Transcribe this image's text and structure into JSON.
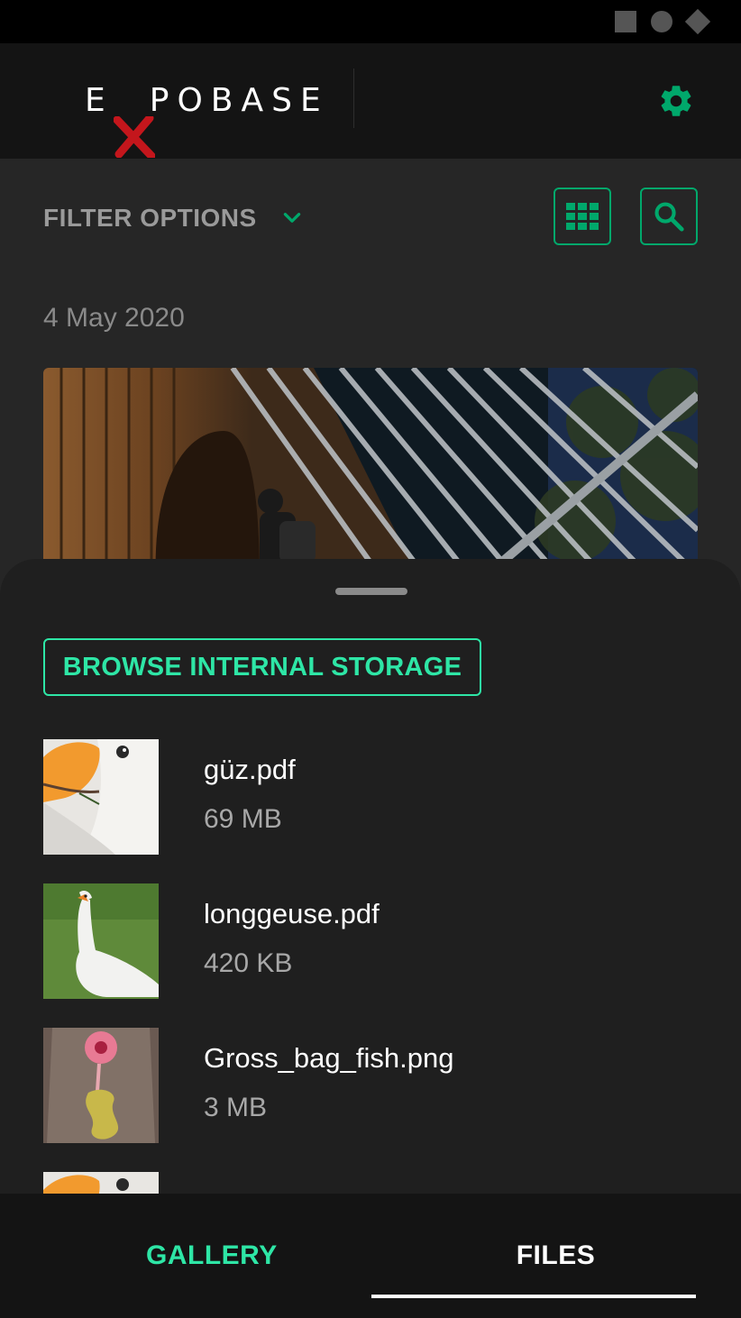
{
  "app": {
    "logo_text_left": "E",
    "logo_text_right": "POBASE",
    "logo_x_color": "#c4161c",
    "accent_color": "#00a86b",
    "accent_light": "#2ee6a6"
  },
  "status_bar": {
    "icons": [
      "stop-square-icon",
      "circle-icon",
      "diamond-icon"
    ]
  },
  "header": {
    "settings_icon": "gear-icon"
  },
  "filter": {
    "label": "FILTER OPTIONS",
    "chevron_icon": "chevron-down-icon",
    "grid_icon": "grid-icon",
    "search_icon": "search-icon"
  },
  "gallery": {
    "date_label": "4 May 2020"
  },
  "sheet": {
    "browse_label": "BROWSE INTERNAL STORAGE",
    "files": [
      {
        "name": "güz.pdf",
        "size": "69 MB"
      },
      {
        "name": "longgeuse.pdf",
        "size": "420 KB"
      },
      {
        "name": "Gross_bag_fish.png",
        "size": "3 MB"
      },
      {
        "name": "",
        "size": ""
      }
    ]
  },
  "nav": {
    "tabs": [
      {
        "label": "GALLERY",
        "active": false
      },
      {
        "label": "FILES",
        "active": true
      }
    ]
  }
}
